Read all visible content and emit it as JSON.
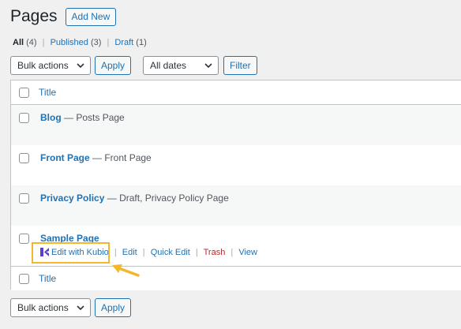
{
  "header": {
    "title": "Pages",
    "add_new_label": "Add New"
  },
  "views": {
    "all": {
      "label": "All",
      "count": "(4)"
    },
    "published": {
      "label": "Published",
      "count": "(3)"
    },
    "draft": {
      "label": "Draft",
      "count": "(1)"
    },
    "separator": "|"
  },
  "filters": {
    "bulk_actions": "Bulk actions",
    "apply_label": "Apply",
    "dates": "All dates",
    "filter_label": "Filter"
  },
  "table": {
    "column_title": "Title",
    "rows": [
      {
        "title": "Blog",
        "state": "— Posts Page"
      },
      {
        "title": "Front Page",
        "state": "— Front Page"
      },
      {
        "title": "Privacy Policy",
        "state": "— Draft, Privacy Policy Page"
      },
      {
        "title": "Sample Page",
        "state": ""
      }
    ],
    "row_actions": {
      "kubio": "Edit with Kubio",
      "edit": "Edit",
      "quick_edit": "Quick Edit",
      "trash": "Trash",
      "view": "View",
      "separator": "|"
    }
  },
  "bottom": {
    "bulk_actions": "Bulk actions",
    "apply_label": "Apply"
  },
  "colors": {
    "link": "#2271b1",
    "trash": "#b32d2e",
    "highlight": "#f3b72e",
    "kubio": "#5a3fd6"
  }
}
